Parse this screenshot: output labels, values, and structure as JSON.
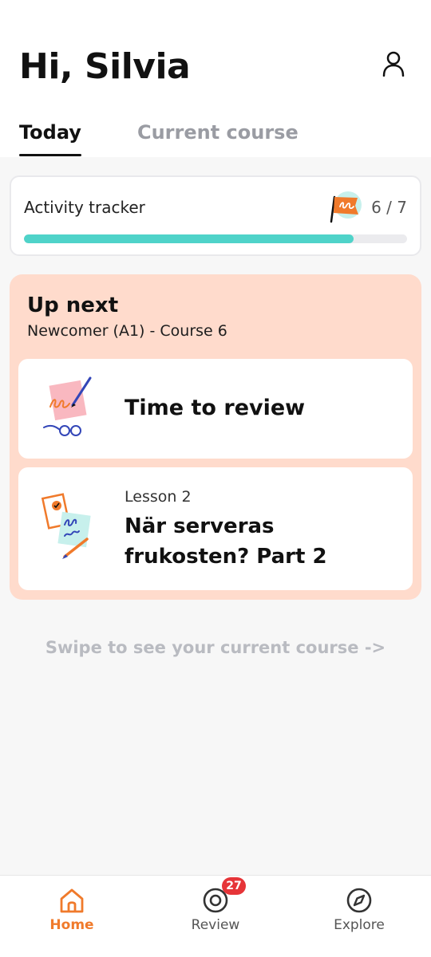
{
  "header": {
    "greeting": "Hi, Silvia",
    "profile_icon": "person-icon"
  },
  "tabs": [
    {
      "label": "Today",
      "active": true
    },
    {
      "label": "Current course",
      "active": false
    }
  ],
  "activity_tracker": {
    "title": "Activity tracker",
    "count_text": "6 / 7",
    "progress": 0.86,
    "flag_icon": "flag-icon"
  },
  "up_next": {
    "title": "Up next",
    "subtitle": "Newcomer (A1) - Course 6",
    "review_card": {
      "title": "Time to review"
    },
    "lesson_card": {
      "label": "Lesson 2",
      "title": "När serveras frukosten? Part 2"
    }
  },
  "swipe_hint": "Swipe to see your current course ->",
  "bottom_nav": {
    "home": {
      "label": "Home",
      "icon": "home-icon",
      "active": true
    },
    "review": {
      "label": "Review",
      "icon": "target-icon",
      "badge": "27"
    },
    "explore": {
      "label": "Explore",
      "icon": "compass-icon"
    }
  },
  "colors": {
    "accent": "#f07a2b",
    "progress": "#4fd3c9",
    "up_next_bg": "#ffdbcc",
    "badge": "#e63438"
  }
}
